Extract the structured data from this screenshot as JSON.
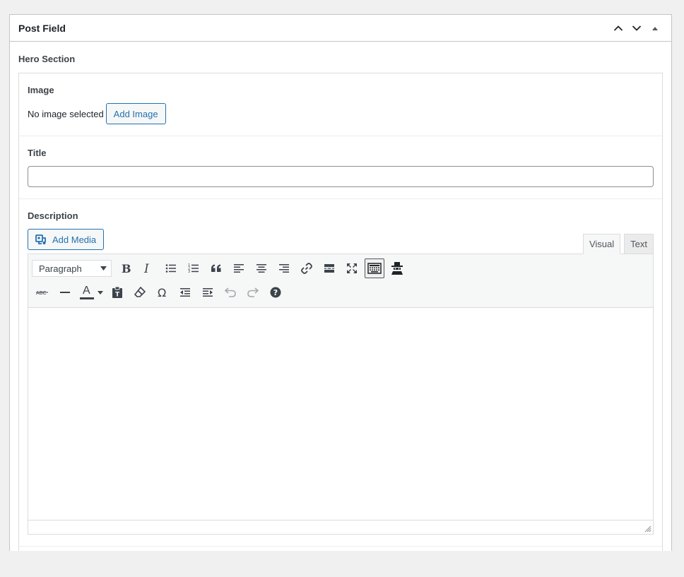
{
  "postbox": {
    "title": "Post Field",
    "actions": [
      "chevron-up-icon",
      "chevron-down-icon",
      "triangle-up-icon"
    ]
  },
  "group": {
    "label": "Hero Section"
  },
  "image_field": {
    "label": "Image",
    "status": "No image selected",
    "button": "Add Image"
  },
  "title_field": {
    "label": "Title",
    "value": ""
  },
  "description_field": {
    "label": "Description",
    "add_media": "Add Media",
    "tabs": {
      "visual": "Visual",
      "text": "Text",
      "active": "Visual"
    },
    "format": "Paragraph",
    "toolbar_row1": [
      "bold-icon",
      "italic-icon",
      "bullet-list-icon",
      "numbered-list-icon",
      "blockquote-icon",
      "align-left-icon",
      "align-center-icon",
      "align-right-icon",
      "link-icon",
      "read-more-icon",
      "fullscreen-icon",
      "toolbar-toggle-icon",
      "spy-icon"
    ],
    "toolbar_row2": [
      "strikethrough-icon",
      "horizontal-line-icon",
      "text-color-icon",
      "paste-text-icon",
      "clear-formatting-icon",
      "special-character-icon",
      "outdent-icon",
      "indent-icon",
      "undo-icon",
      "redo-icon",
      "help-icon"
    ],
    "text_color_letter": "A",
    "content": ""
  },
  "colors": {
    "accent": "#2271b1",
    "border": "#c3c4c7",
    "background": "#f0f0f1"
  }
}
